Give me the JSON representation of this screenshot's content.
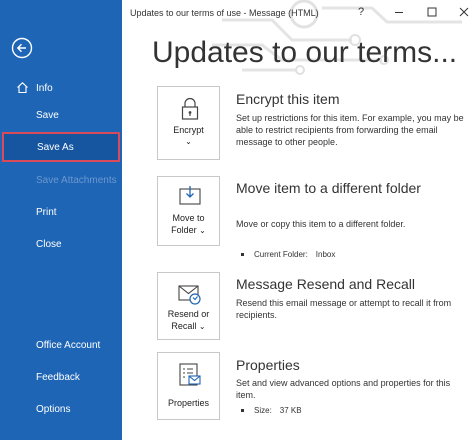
{
  "window": {
    "title": "Updates to our terms of use  -  Message (HTML)",
    "help": "?"
  },
  "sidebar": {
    "items": [
      {
        "label": "Info"
      },
      {
        "label": "Save"
      },
      {
        "label": "Save As"
      },
      {
        "label": "Save Attachments"
      },
      {
        "label": "Print"
      },
      {
        "label": "Close"
      },
      {
        "label": "Office Account"
      },
      {
        "label": "Feedback"
      },
      {
        "label": "Options"
      }
    ]
  },
  "main": {
    "page_title": "Updates to our terms...",
    "sections": [
      {
        "button_line1": "Encrypt",
        "title": "Encrypt this item",
        "desc": "Set up restrictions for this item. For example, you may be able to restrict recipients from forwarding the email message to other people."
      },
      {
        "button_line1": "Move to",
        "button_line2": "Folder",
        "title": "Move item to a different folder",
        "desc": "Move or copy this item to a different folder.",
        "bullet_label": "Current Folder:",
        "bullet_value": "Inbox"
      },
      {
        "button_line1": "Resend or",
        "button_line2": "Recall",
        "title": "Message Resend and Recall",
        "desc": "Resend this email message or attempt to recall it from recipients."
      },
      {
        "button_line1": "Properties",
        "title": "Properties",
        "desc": "Set and view advanced options and properties for this item.",
        "bullet_label": "Size:",
        "bullet_value": "37 KB"
      }
    ]
  },
  "colors": {
    "sidebar_bg": "#1e65b5",
    "selected_bg": "#1656a0",
    "selected_border": "#d94a5a"
  }
}
